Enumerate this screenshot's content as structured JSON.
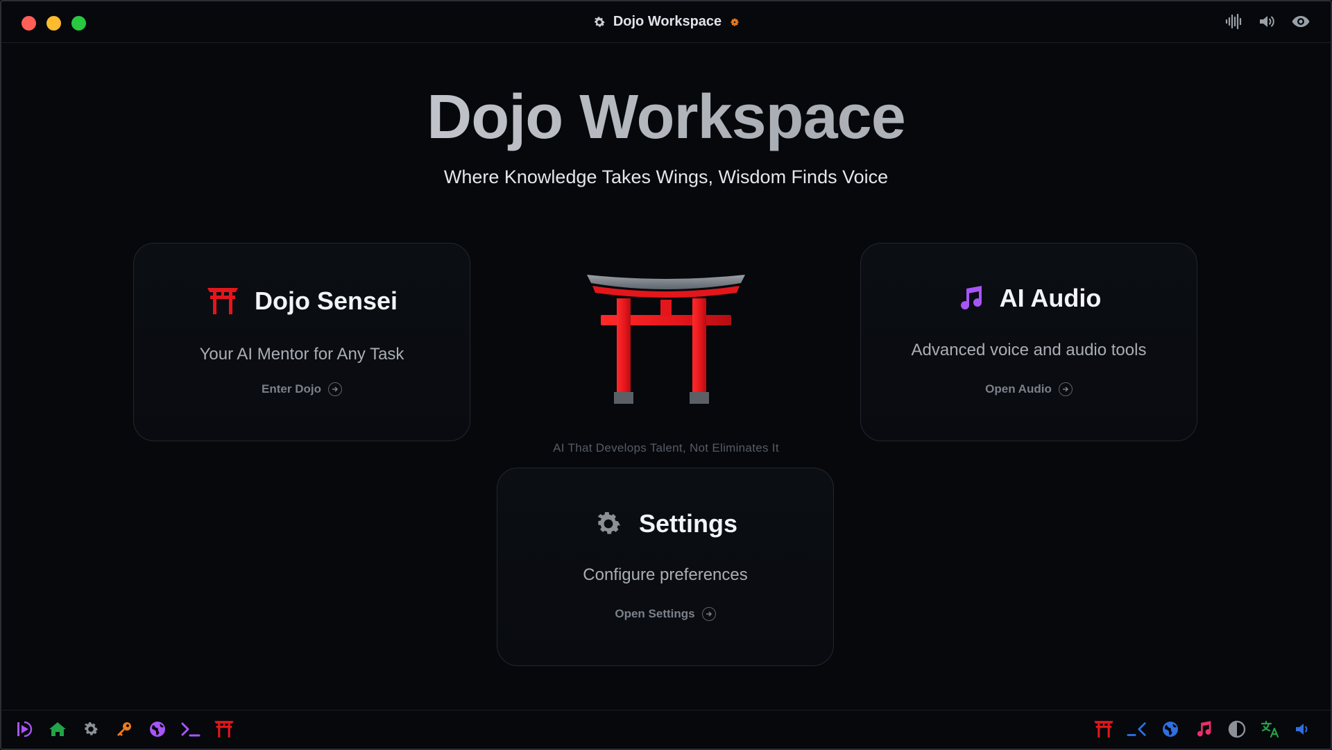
{
  "window": {
    "title": "Dojo Workspace",
    "title_icon": "gear-icon",
    "badge_icon": "small-gear-badge-icon",
    "right_controls": [
      "waveform-icon",
      "speaker-icon",
      "eye-icon"
    ]
  },
  "hero": {
    "title": "Dojo Workspace",
    "subtitle": "Where Knowledge Takes Wings, Wisdom Finds Voice",
    "tagline": "AI That Develops Talent, Not Eliminates It"
  },
  "cards": {
    "sensei": {
      "icon": "torii-gate-icon",
      "title": "Dojo Sensei",
      "description": "Your AI Mentor for Any Task",
      "link": "Enter Dojo"
    },
    "audio": {
      "icon": "music-note-icon",
      "title": "AI Audio",
      "description": "Advanced voice and audio tools",
      "link": "Open Audio"
    },
    "settings": {
      "icon": "gear-icon",
      "title": "Settings",
      "description": "Configure preferences",
      "link": "Open Settings"
    }
  },
  "bottombar": {
    "left_icons": [
      "voice-toggle-icon",
      "home-icon",
      "gear-icon",
      "key-icon",
      "globe-icon",
      "terminal-icon",
      "torii-gate-icon"
    ],
    "right_icons": [
      "torii-gate-icon",
      "code-icon",
      "globe-icon",
      "music-note-icon",
      "contrast-icon",
      "translate-icon",
      "speaker-icon"
    ]
  },
  "colors": {
    "background": "#06080c",
    "torii_red": "#e3161b",
    "audio_purple": "#a855f7",
    "home_green": "#22a447",
    "key_orange": "#f07a1a",
    "blue": "#2f6fe0",
    "pink": "#ec2f6b"
  }
}
